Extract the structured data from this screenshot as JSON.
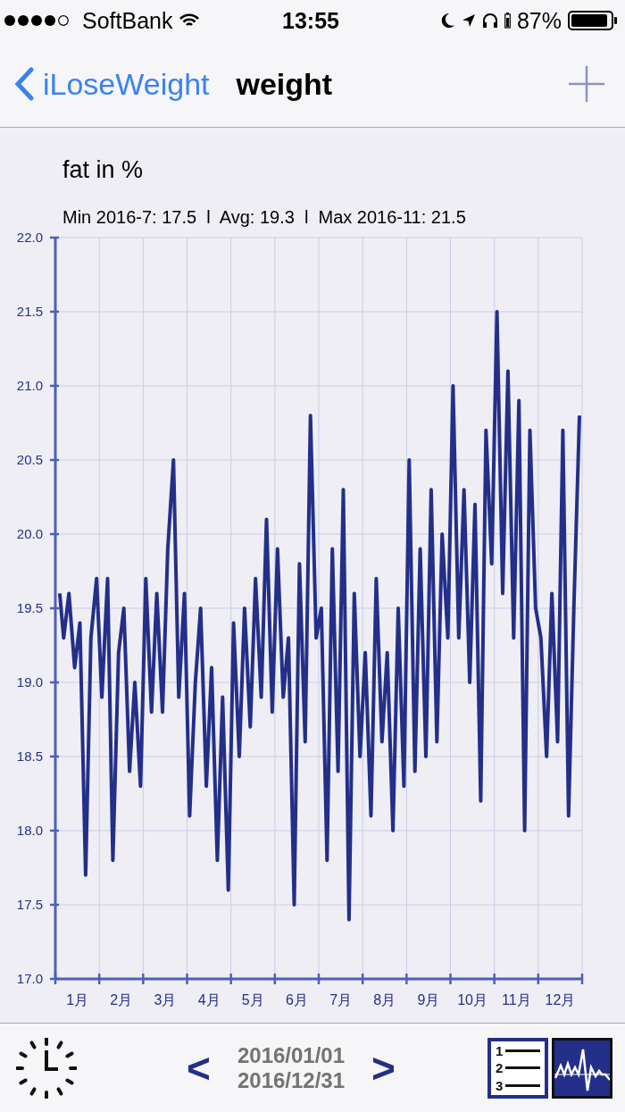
{
  "status_bar": {
    "carrier": "SoftBank",
    "time": "13:55",
    "battery": "87%"
  },
  "nav_bar": {
    "back": "iLoseWeight",
    "title": "weight"
  },
  "summary": "Min 2016-7: 17.5  l  Avg: 19.3  l  Max 2016-11: 21.5",
  "chart_data": {
    "type": "line",
    "title": "fat in %",
    "grid": true,
    "xlim": [
      0,
      12
    ],
    "ylim": [
      17,
      22
    ],
    "yticks": [
      {
        "value": 17,
        "label": "17.0"
      },
      {
        "value": 17.5,
        "label": "17.5"
      },
      {
        "value": 18,
        "label": "18.0"
      },
      {
        "value": 18.5,
        "label": "18.5"
      },
      {
        "value": 19,
        "label": "19.0"
      },
      {
        "value": 19.5,
        "label": "19.5"
      },
      {
        "value": 20,
        "label": "20.0"
      },
      {
        "value": 20.5,
        "label": "20.5"
      },
      {
        "value": 21,
        "label": "21.0"
      },
      {
        "value": 21.5,
        "label": "21.5"
      },
      {
        "value": 22,
        "label": "22.0"
      }
    ],
    "xticks": [
      {
        "value": 0.5,
        "label": "1月"
      },
      {
        "value": 1.5,
        "label": "2月"
      },
      {
        "value": 2.5,
        "label": "3月"
      },
      {
        "value": 3.5,
        "label": "4月"
      },
      {
        "value": 4.5,
        "label": "5月"
      },
      {
        "value": 5.5,
        "label": "6月"
      },
      {
        "value": 6.5,
        "label": "7月"
      },
      {
        "value": 7.5,
        "label": "8月"
      },
      {
        "value": 8.5,
        "label": "9月"
      },
      {
        "value": 9.5,
        "label": "10月"
      },
      {
        "value": 10.5,
        "label": "11月"
      },
      {
        "value": 11.5,
        "label": "12月"
      }
    ],
    "x": [
      0.1,
      0.19,
      0.31,
      0.44,
      0.56,
      0.69,
      0.81,
      0.94,
      1.06,
      1.19,
      1.31,
      1.44,
      1.56,
      1.69,
      1.81,
      1.94,
      2.06,
      2.19,
      2.31,
      2.44,
      2.56,
      2.69,
      2.81,
      2.94,
      3.06,
      3.19,
      3.31,
      3.44,
      3.56,
      3.69,
      3.81,
      3.94,
      4.06,
      4.19,
      4.31,
      4.44,
      4.56,
      4.69,
      4.81,
      4.94,
      5.06,
      5.19,
      5.31,
      5.44,
      5.56,
      5.69,
      5.81,
      5.94,
      6.06,
      6.19,
      6.31,
      6.44,
      6.56,
      6.69,
      6.81,
      6.94,
      7.06,
      7.19,
      7.31,
      7.44,
      7.56,
      7.69,
      7.81,
      7.94,
      8.06,
      8.19,
      8.31,
      8.44,
      8.56,
      8.69,
      8.81,
      8.94,
      9.06,
      9.19,
      9.31,
      9.44,
      9.56,
      9.69,
      9.81,
      9.94,
      10.06,
      10.19,
      10.31,
      10.44,
      10.56,
      10.69,
      10.81,
      10.94,
      11.06,
      11.19,
      11.31,
      11.44,
      11.56,
      11.69,
      11.81,
      11.94
    ],
    "series": [
      {
        "color": "#232f88",
        "values": [
          19.6,
          19.3,
          19.6,
          19.1,
          19.4,
          17.7,
          19.3,
          19.7,
          18.9,
          19.7,
          17.8,
          19.2,
          19.5,
          18.4,
          19.0,
          18.3,
          19.7,
          18.8,
          19.6,
          18.8,
          19.9,
          20.5,
          18.9,
          19.6,
          18.1,
          19.0,
          19.5,
          18.3,
          19.1,
          17.8,
          18.9,
          17.6,
          19.4,
          18.5,
          19.5,
          18.7,
          19.7,
          18.9,
          20.1,
          18.8,
          19.9,
          18.9,
          19.3,
          17.5,
          19.8,
          18.6,
          20.8,
          19.3,
          19.5,
          17.8,
          19.9,
          18.4,
          20.3,
          17.4,
          19.6,
          18.5,
          19.2,
          18.1,
          19.7,
          18.6,
          19.2,
          18.0,
          19.5,
          18.3,
          20.5,
          18.4,
          19.9,
          18.5,
          20.3,
          18.6,
          20.0,
          19.3,
          21.0,
          19.3,
          20.3,
          19.0,
          20.2,
          18.2,
          20.7,
          19.8,
          21.5,
          19.6,
          21.1,
          19.3,
          20.9,
          18.0,
          20.7,
          19.5,
          19.3,
          18.5,
          19.6,
          18.6,
          20.7,
          18.1,
          19.5,
          20.8
        ]
      }
    ]
  },
  "toolbar": {
    "start_date": "2016/01/01",
    "end_date": "2016/12/31",
    "prev": "<",
    "next": ">",
    "list_numbers": [
      "1",
      "2",
      "3"
    ]
  }
}
